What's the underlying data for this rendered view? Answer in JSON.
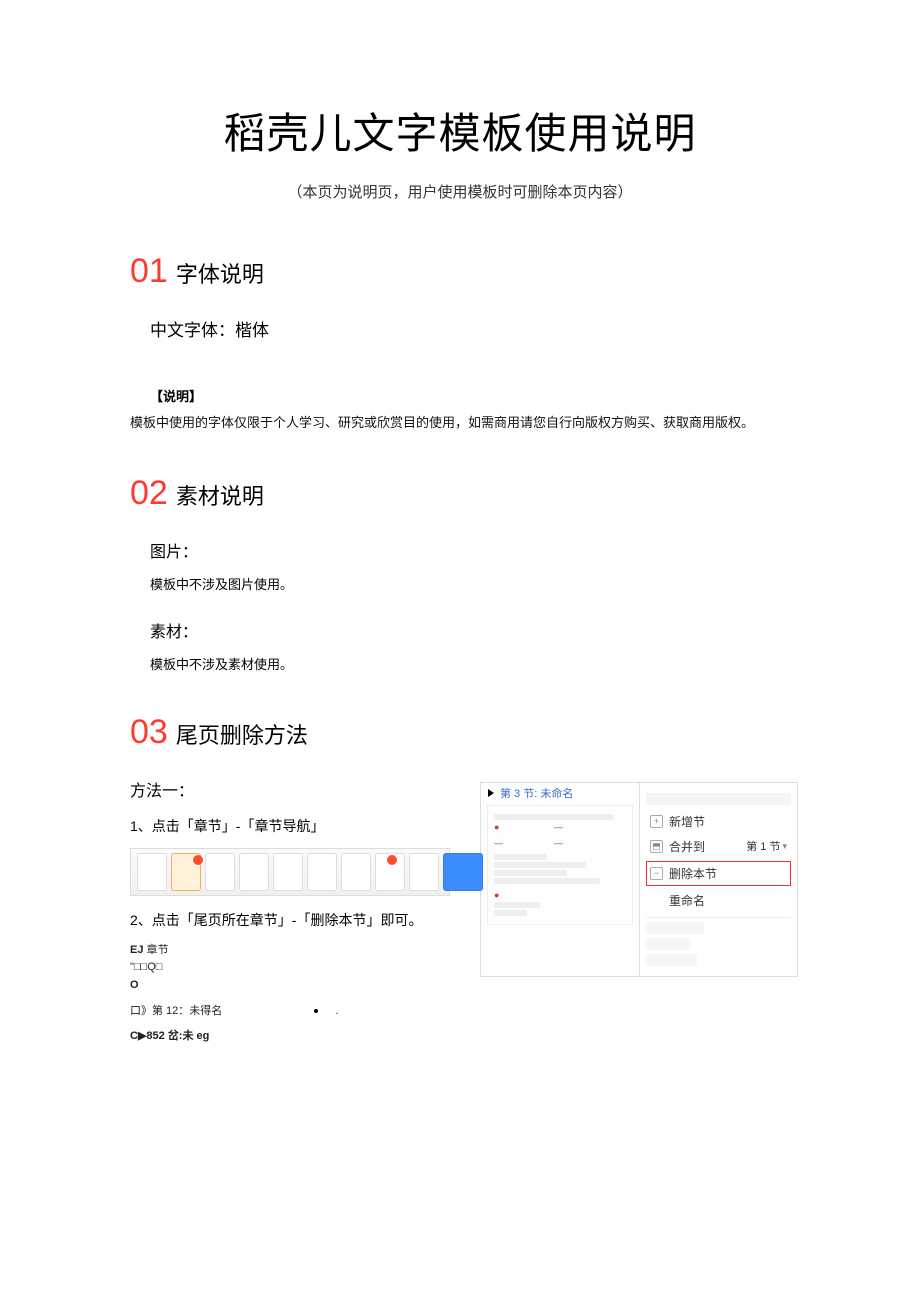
{
  "title": "稻壳儿文字模板使用说明",
  "subtitle": "（本页为说明页，用户使用模板时可删除本页内容）",
  "sections": {
    "s1": {
      "num": "01",
      "title": "字体说明",
      "cn_font_line": "中文字体：楷体",
      "note_label": "【说明】",
      "note_body": "模板中使用的字体仅限于个人学习、研究或欣赏目的使用，如需商用请您自行向版权方购买、获取商用版权。"
    },
    "s2": {
      "num": "02",
      "title": "素材说明",
      "img_h": "图片：",
      "img_body": "模板中不涉及图片使用。",
      "mat_h": "素材：",
      "mat_body": "模板中不涉及素材使用。"
    },
    "s3": {
      "num": "03",
      "title": "尾页删除方法",
      "method1": "方法一：",
      "step1": "1、点击「章节」-「章节导航」",
      "step2": "2、点击「尾页所在章节」-「删除本节」即可。",
      "outline": {
        "l1a": "EJ",
        "l1b": "章节",
        "l2": "\"□□Q□",
        "l3": "O",
        "l4": "口》第 12：未得名",
        "l5": "C▶852 岔:未 eg"
      },
      "panel_header": "第 3 节: 未命名",
      "menu": {
        "m1": "新增节",
        "m2": "合并到",
        "m2_right": "第 1 节",
        "m3": "删除本节",
        "m4": "重命名"
      }
    }
  }
}
